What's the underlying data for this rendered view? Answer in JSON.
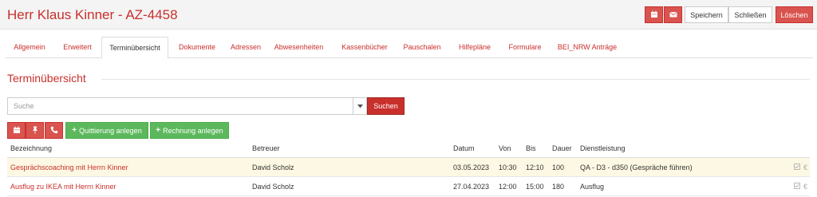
{
  "header": {
    "title": "Herr Klaus Kinner - AZ-4458",
    "save_label": "Speichern",
    "close_label": "Schließen",
    "delete_label": "Löschen",
    "icons": [
      "calendar-icon",
      "envelope-icon"
    ]
  },
  "tabs": [
    {
      "label": "Allgemein",
      "active": false
    },
    {
      "label": "Erweitert",
      "active": false
    },
    {
      "label": "Terminübersicht",
      "active": true
    },
    {
      "label": "Dokumente",
      "active": false
    },
    {
      "label": "Adressen",
      "active": false
    },
    {
      "label": "Abwesenheiten",
      "active": false
    },
    {
      "label": "Kassenbücher",
      "active": false
    },
    {
      "label": "Pauschalen",
      "active": false
    },
    {
      "label": "Hilfepläne",
      "active": false
    },
    {
      "label": "Formulare",
      "active": false
    },
    {
      "label": "BEI_NRW Anträge",
      "active": false
    }
  ],
  "section": {
    "title": "Terminübersicht"
  },
  "search": {
    "placeholder": "Suche",
    "button_label": "Suchen"
  },
  "actions": {
    "icons": [
      "calendar-icon",
      "pin-icon",
      "phone-icon"
    ],
    "quittierung_label": "Quittierung anlegen",
    "rechnung_label": "Rechnung anlegen"
  },
  "table": {
    "columns": [
      "Bezeichnung",
      "Betreuer",
      "Datum",
      "Von",
      "Bis",
      "Dauer",
      "Dienstleistung"
    ],
    "rows": [
      {
        "bezeichnung": "Gesprächscoaching mit Herrn Kinner",
        "betreuer": "David Scholz",
        "datum": "03.05.2023",
        "von": "10:30",
        "bis": "12:10",
        "dauer": "100",
        "dienstleistung": "QA - D3 - d350 (Gespräche führen)",
        "highlighted": true
      },
      {
        "bezeichnung": "Ausflug zu IKEA mit Herrn Kinner",
        "betreuer": "David Scholz",
        "datum": "27.04.2023",
        "von": "12:00",
        "bis": "15:00",
        "dauer": "180",
        "dienstleistung": "Ausflug",
        "highlighted": false
      }
    ],
    "row_icons": [
      "checkbox-icon",
      "euro-icon"
    ],
    "euro_symbol": "€"
  },
  "colors": {
    "accent": "#c9302c",
    "danger": "#d9534f",
    "success": "#5cb85c",
    "highlight_row": "#fcf8e3"
  }
}
